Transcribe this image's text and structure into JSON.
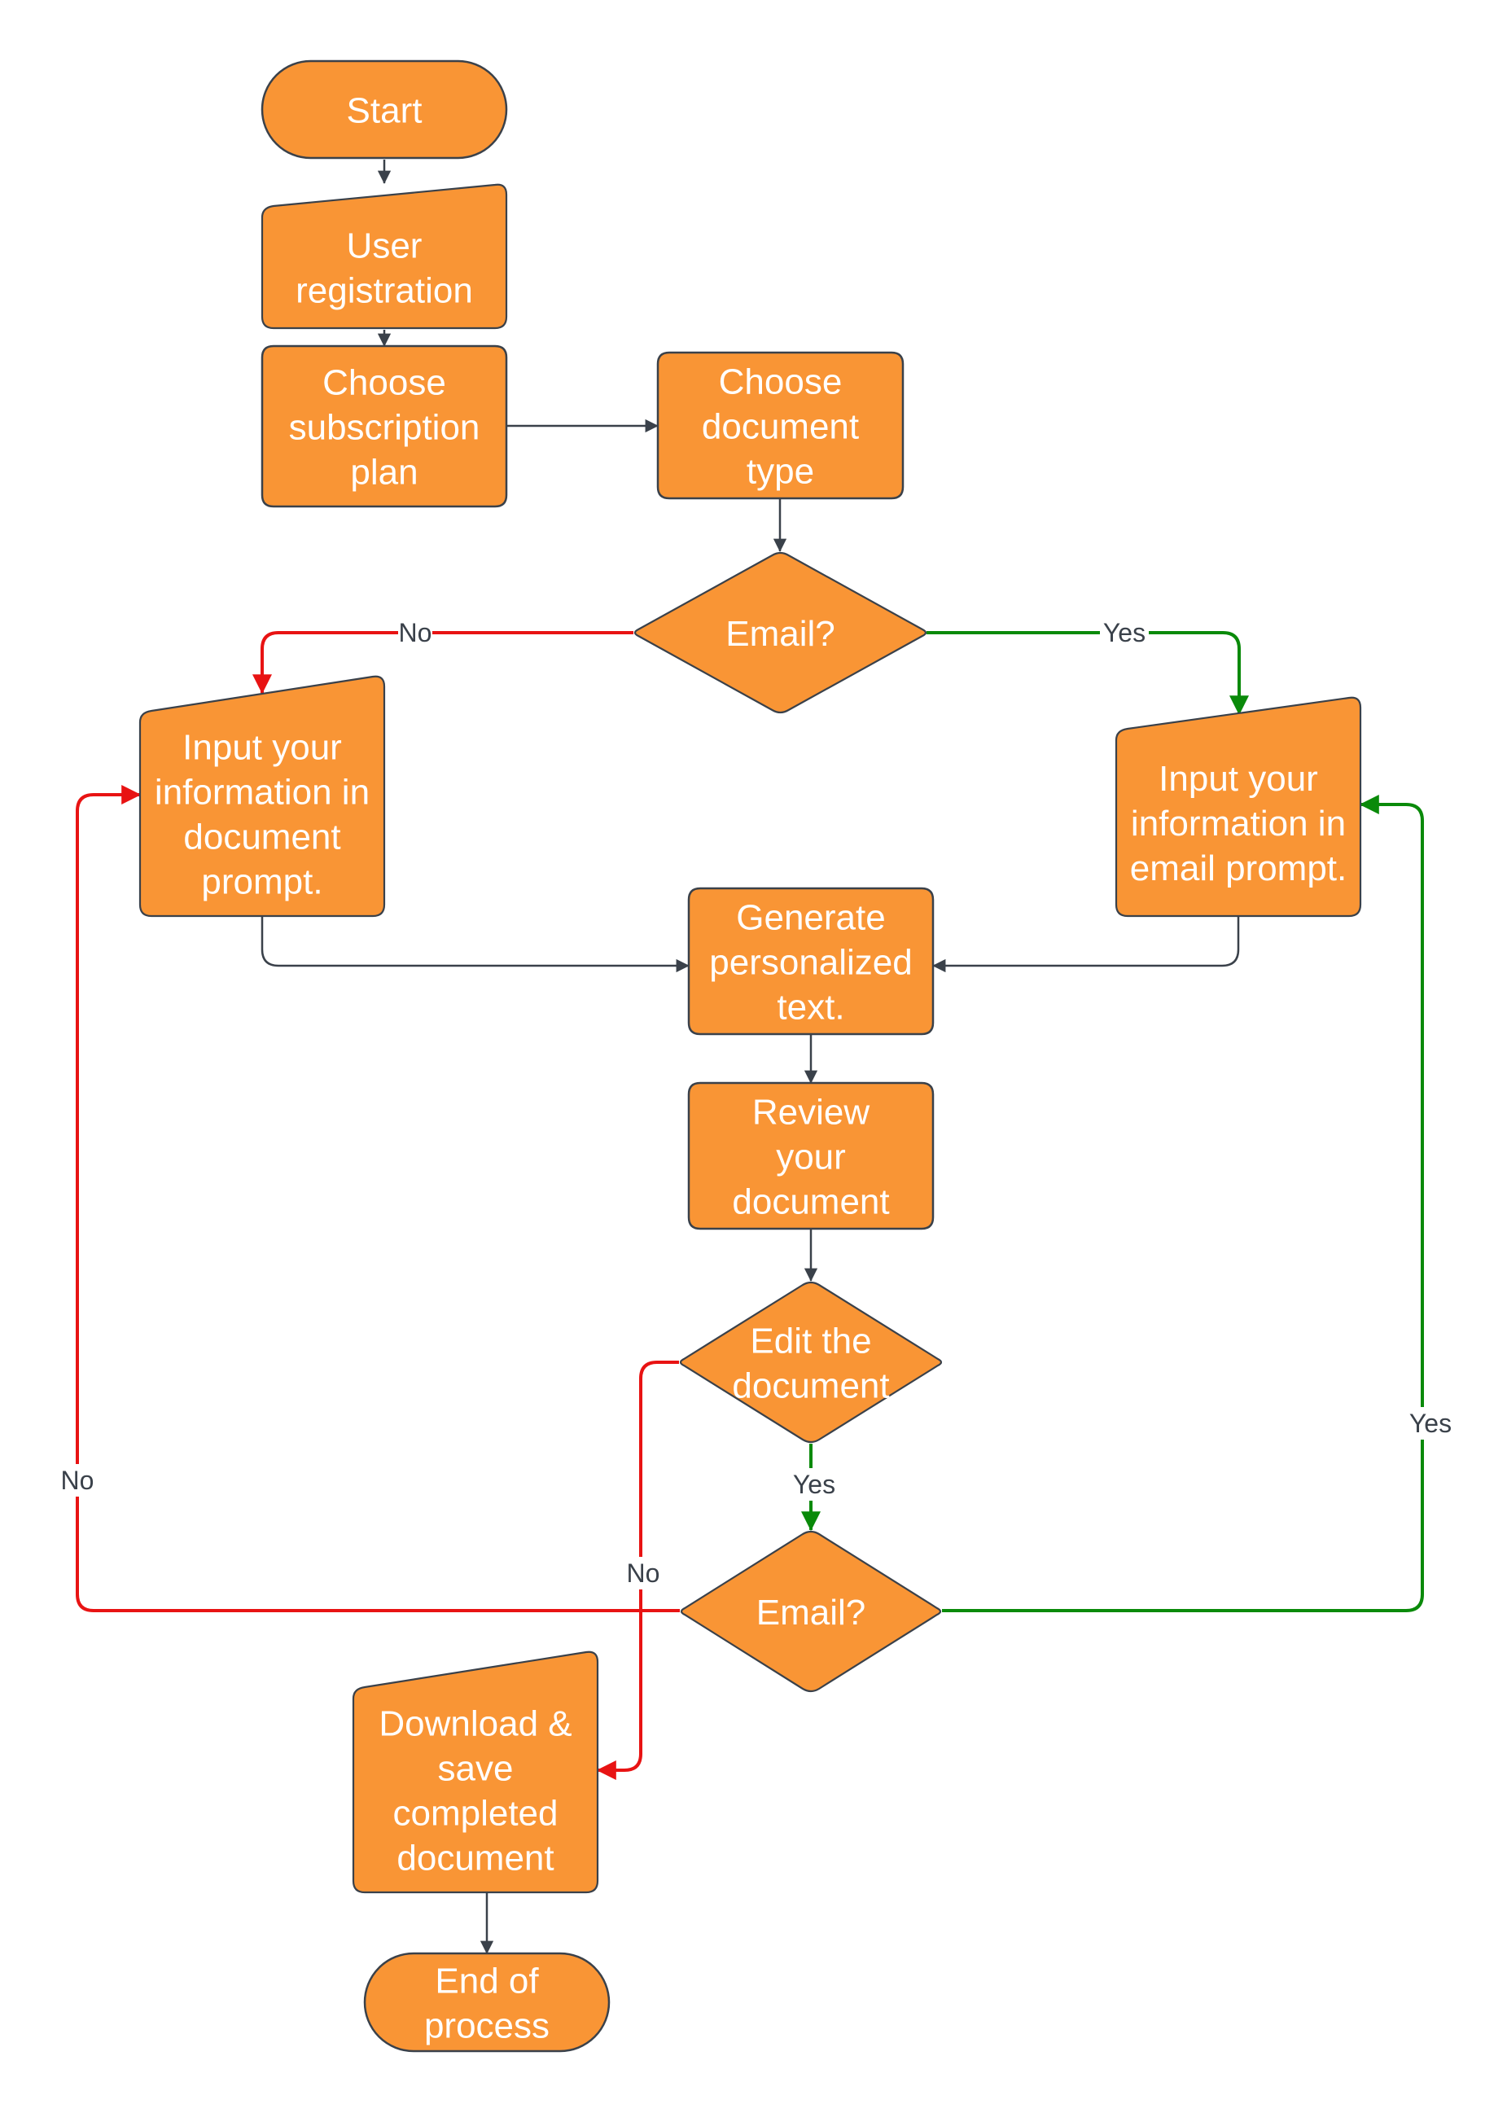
{
  "diagram": {
    "type": "flowchart",
    "colors": {
      "node_fill": "#f99535",
      "node_stroke": "#3a414a",
      "node_text": "#ffffff",
      "connector_default": "#3a414a",
      "connector_no": "#e81313",
      "connector_yes": "#0a8a0a",
      "label_text": "#3a414a"
    },
    "nodes": [
      {
        "id": "start",
        "shape": "terminator",
        "lines": [
          "Start"
        ]
      },
      {
        "id": "user-registration",
        "shape": "manual-input",
        "lines": [
          "User",
          "registration"
        ]
      },
      {
        "id": "choose-subscription-plan",
        "shape": "process",
        "lines": [
          "Choose",
          "subscription",
          "plan"
        ]
      },
      {
        "id": "choose-document-type",
        "shape": "process",
        "lines": [
          "Choose",
          "document",
          "type"
        ]
      },
      {
        "id": "email-decision-1",
        "shape": "decision",
        "lines": [
          "Email?"
        ]
      },
      {
        "id": "input-document-prompt",
        "shape": "manual-input",
        "lines": [
          "Input your",
          "information in",
          "document",
          "prompt."
        ]
      },
      {
        "id": "input-email-prompt",
        "shape": "manual-input",
        "lines": [
          "Input your",
          "information in",
          "email prompt."
        ]
      },
      {
        "id": "generate-personalized-text",
        "shape": "process",
        "lines": [
          "Generate",
          "personalized",
          "text."
        ]
      },
      {
        "id": "review-document",
        "shape": "process",
        "lines": [
          "Review",
          "your",
          "document"
        ]
      },
      {
        "id": "edit-document-decision",
        "shape": "decision",
        "lines": [
          "Edit the",
          "document"
        ]
      },
      {
        "id": "email-decision-2",
        "shape": "decision",
        "lines": [
          "Email?"
        ]
      },
      {
        "id": "download-save",
        "shape": "manual-input",
        "lines": [
          "Download &",
          "save",
          "completed",
          "document"
        ]
      },
      {
        "id": "end",
        "shape": "terminator",
        "lines": [
          "End of",
          "process"
        ]
      }
    ],
    "edges": [
      {
        "from": "start",
        "to": "user-registration",
        "kind": "default",
        "label": ""
      },
      {
        "from": "user-registration",
        "to": "choose-subscription-plan",
        "kind": "default",
        "label": ""
      },
      {
        "from": "choose-subscription-plan",
        "to": "choose-document-type",
        "kind": "default",
        "label": ""
      },
      {
        "from": "choose-document-type",
        "to": "email-decision-1",
        "kind": "default",
        "label": ""
      },
      {
        "from": "email-decision-1",
        "to": "input-document-prompt",
        "kind": "no",
        "label": "No"
      },
      {
        "from": "email-decision-1",
        "to": "input-email-prompt",
        "kind": "yes",
        "label": "Yes"
      },
      {
        "from": "input-document-prompt",
        "to": "generate-personalized-text",
        "kind": "default",
        "label": ""
      },
      {
        "from": "input-email-prompt",
        "to": "generate-personalized-text",
        "kind": "default",
        "label": ""
      },
      {
        "from": "generate-personalized-text",
        "to": "review-document",
        "kind": "default",
        "label": ""
      },
      {
        "from": "review-document",
        "to": "edit-document-decision",
        "kind": "default",
        "label": ""
      },
      {
        "from": "edit-document-decision",
        "to": "email-decision-2",
        "kind": "yes",
        "label": "Yes"
      },
      {
        "from": "edit-document-decision",
        "to": "download-save",
        "kind": "no",
        "label": "No"
      },
      {
        "from": "email-decision-2",
        "to": "input-document-prompt",
        "kind": "no",
        "label": "No"
      },
      {
        "from": "email-decision-2",
        "to": "input-email-prompt",
        "kind": "yes",
        "label": "Yes"
      },
      {
        "from": "download-save",
        "to": "end",
        "kind": "default",
        "label": ""
      }
    ]
  }
}
